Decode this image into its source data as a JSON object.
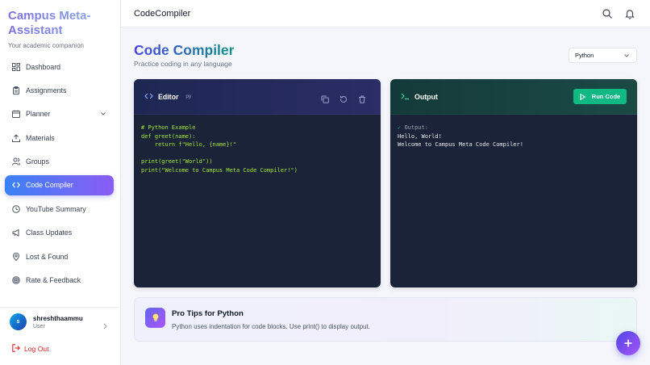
{
  "brand": {
    "title": "Campus Meta-Assistant",
    "subtitle": "Your academic companion"
  },
  "sidebar": {
    "items": [
      {
        "label": "Dashboard",
        "icon": "dashboard-icon"
      },
      {
        "label": "Assignments",
        "icon": "clipboard-icon"
      },
      {
        "label": "Planner",
        "icon": "calendar-icon",
        "has_submenu": true
      },
      {
        "label": "Materials",
        "icon": "upload-icon"
      },
      {
        "label": "Groups",
        "icon": "users-icon"
      },
      {
        "label": "Code Compiler",
        "icon": "code-icon",
        "active": true
      },
      {
        "label": "YouTube Summary",
        "icon": "clock-icon"
      },
      {
        "label": "Class Updates",
        "icon": "megaphone-icon"
      },
      {
        "label": "Lost & Found",
        "icon": "map-pin-icon"
      },
      {
        "label": "Rate & Feedback",
        "icon": "target-icon"
      }
    ],
    "user": {
      "initial": "s",
      "name": "shreshthaammu",
      "role": "User"
    },
    "logout_label": "Log Out"
  },
  "topbar": {
    "title": "CodeCompiler"
  },
  "main": {
    "title": "Code Compiler",
    "subtitle": "Practice coding in any language",
    "language": "Python"
  },
  "editor": {
    "label": "Editor",
    "extension": "py",
    "code": "# Python Example\ndef greet(name):\n    return f\"Hello, {name}!\"\n\nprint(greet(\"World\"))\nprint(\"Welcome to Campus Meta Code Compiler!\")"
  },
  "output": {
    "label": "Output",
    "run_label": "Run Code",
    "header": "Output:",
    "check": "✓",
    "text": "Hello, World!\nWelcome to Campus Meta Code Compiler!"
  },
  "tips": {
    "title": "Pro Tips for Python",
    "text": "Python uses indentation for code blocks. Use print() to display output."
  },
  "colors": {
    "accent": "#6366f1",
    "run": "#10b981",
    "logout": "#dc2626",
    "editor_bg": "#1b2338"
  }
}
